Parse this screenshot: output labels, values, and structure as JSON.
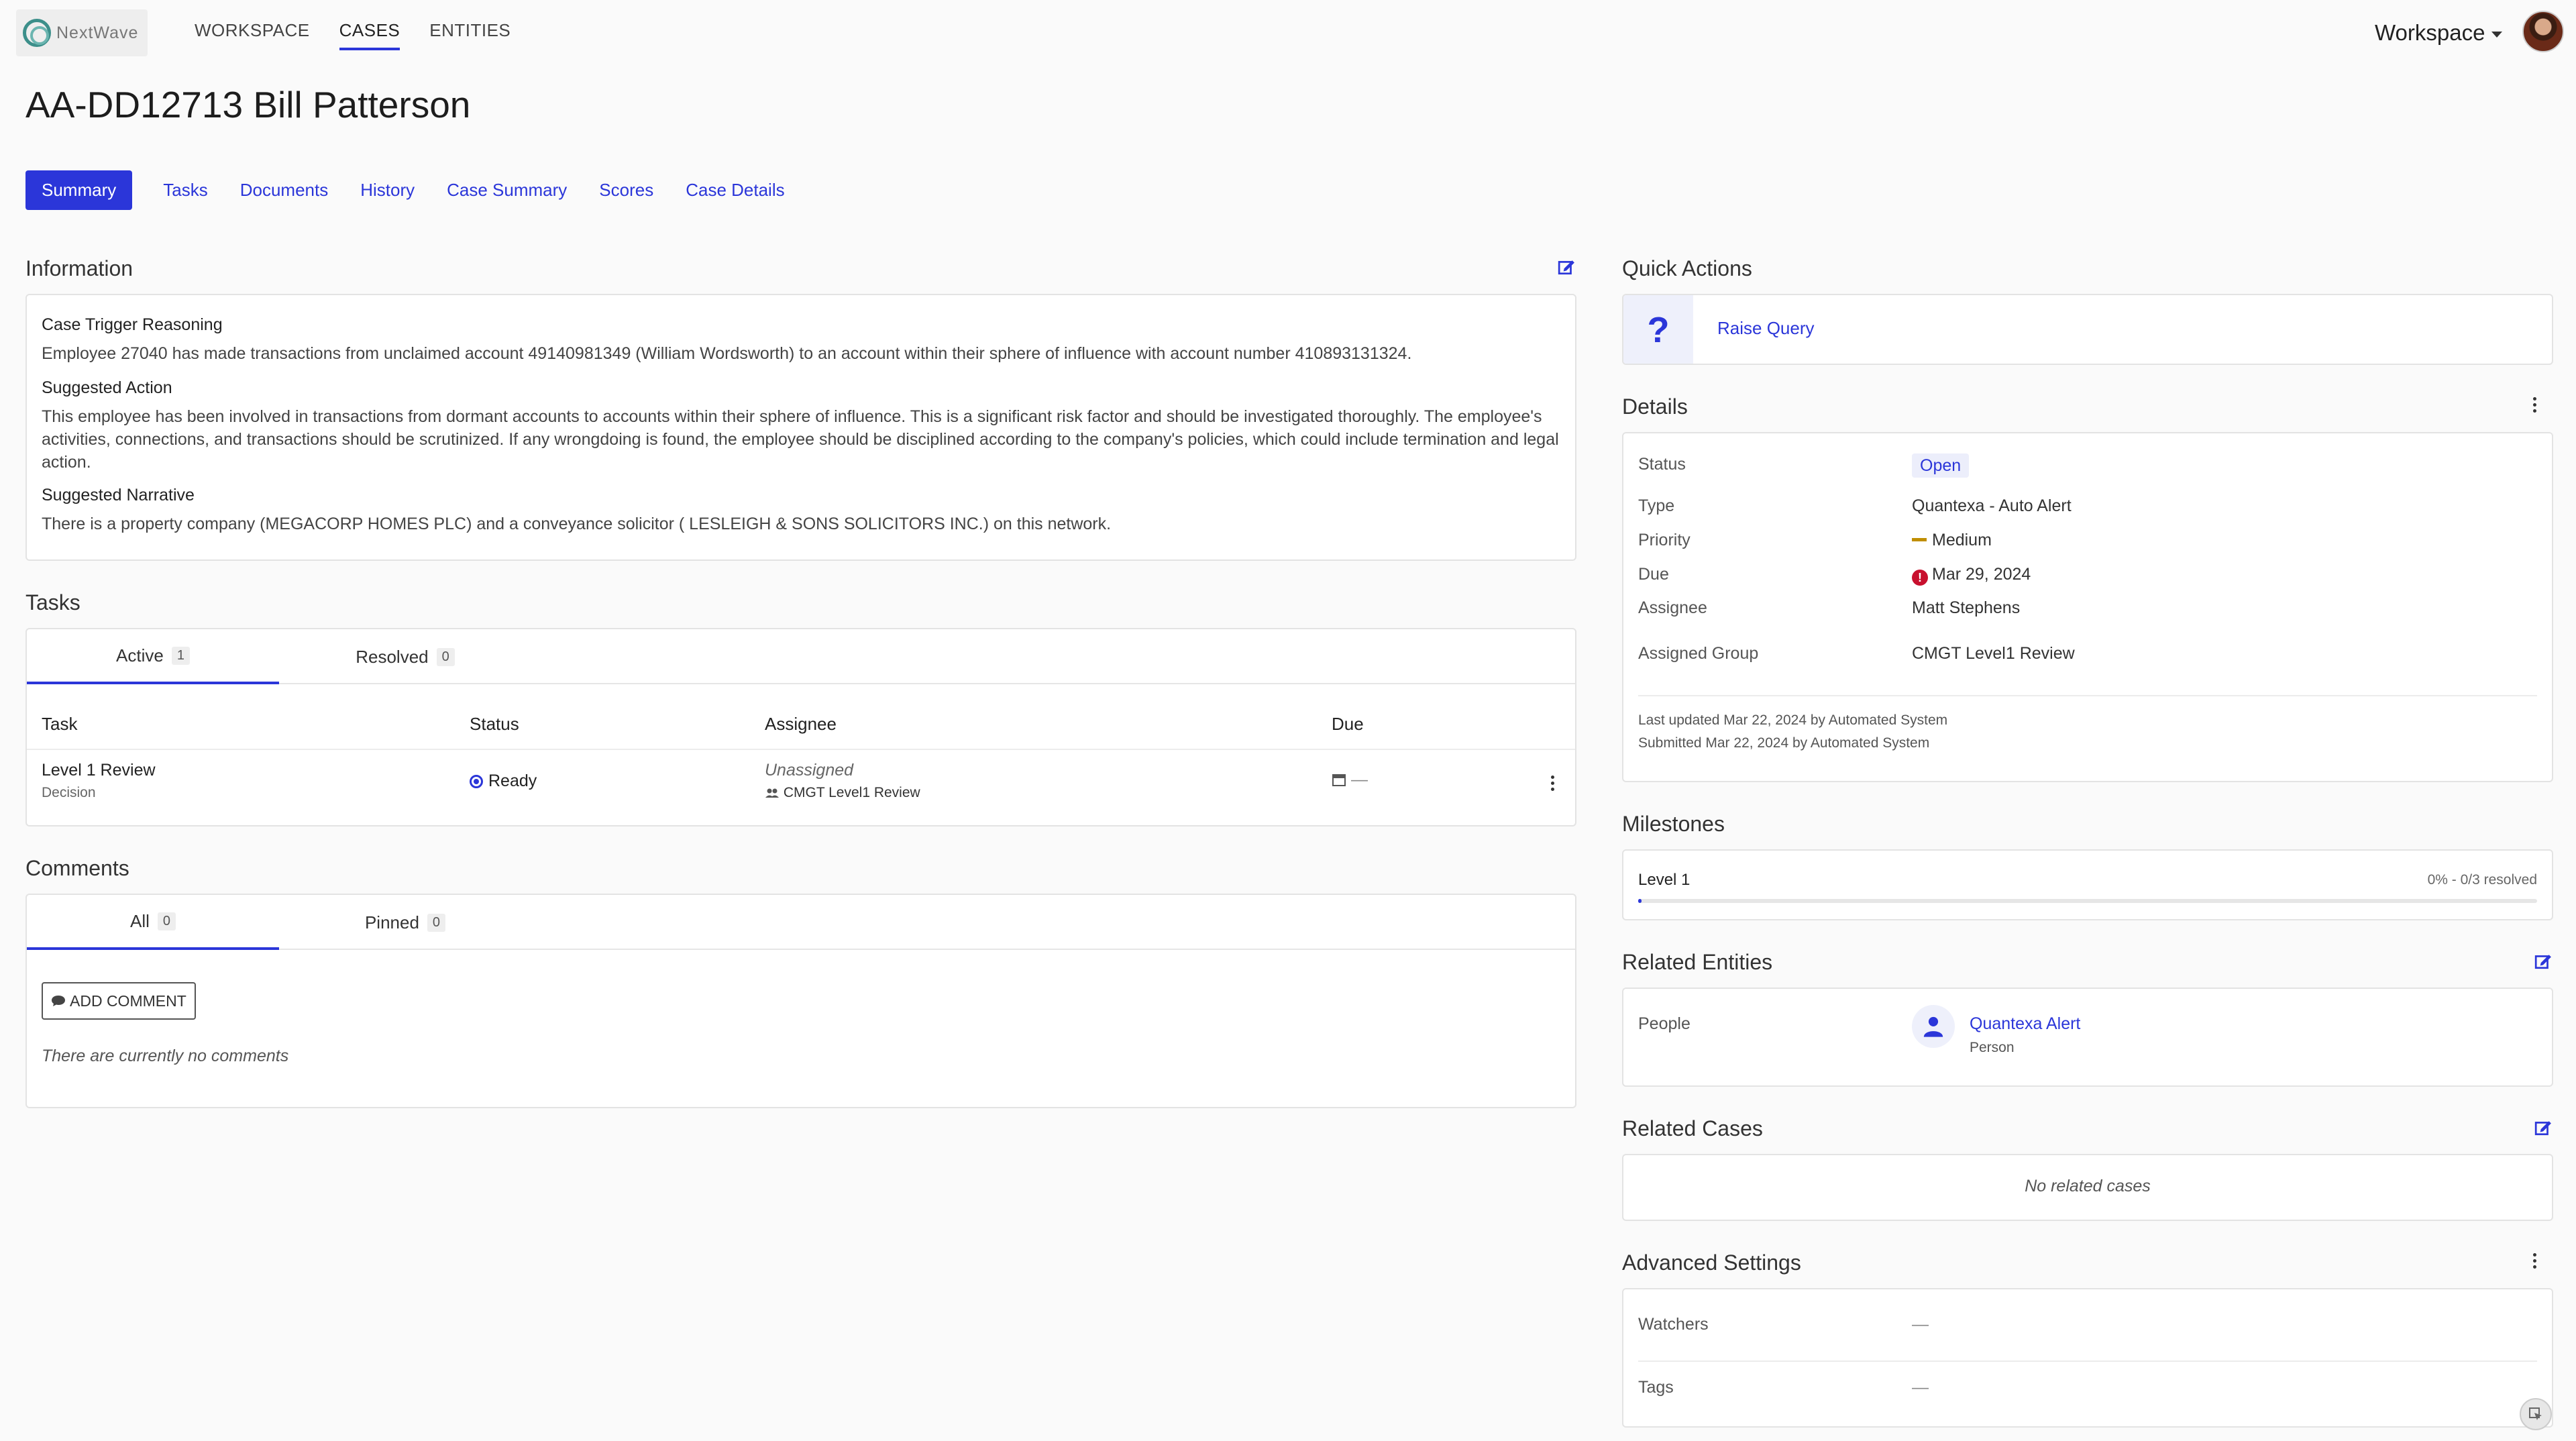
{
  "app": {
    "logo_text": "NextWave",
    "nav": [
      "WORKSPACE",
      "CASES",
      "ENTITIES"
    ],
    "workspace_label": "Workspace"
  },
  "case": {
    "title": "AA-DD12713 Bill Patterson"
  },
  "tabs": [
    "Summary",
    "Tasks",
    "Documents",
    "History",
    "Case Summary",
    "Scores",
    "Case Details"
  ],
  "information": {
    "title": "Information",
    "trigger_label": "Case Trigger Reasoning",
    "trigger_text": "Employee 27040 has made transactions from unclaimed account 49140981349 (William Wordsworth) to an account within their sphere of influence with account number 410893131324.",
    "action_label": "Suggested Action",
    "action_text": "This employee has been involved in transactions from dormant accounts to accounts within their sphere of influence. This is a significant risk factor and should be investigated thoroughly. The employee's activities, connections, and transactions should be scrutinized. If any wrongdoing is found, the employee should be disciplined according to the company's policies, which could include termination and legal action.",
    "narrative_label": "Suggested Narrative",
    "narrative_text": "There is a property company (MEGACORP HOMES PLC) and a conveyance solicitor ( LESLEIGH & SONS SOLICITORS INC.) on this network."
  },
  "tasks": {
    "title": "Tasks",
    "tabs": [
      {
        "label": "Active",
        "count": "1"
      },
      {
        "label": "Resolved",
        "count": "0"
      }
    ],
    "headers": [
      "Task",
      "Status",
      "Assignee",
      "Due"
    ],
    "rows": [
      {
        "task": "Level 1 Review",
        "task_sub": "Decision",
        "status": "Ready",
        "assignee": "Unassigned",
        "group": "CMGT Level1 Review",
        "due": "—"
      }
    ]
  },
  "comments": {
    "title": "Comments",
    "tabs": [
      {
        "label": "All",
        "count": "0"
      },
      {
        "label": "Pinned",
        "count": "0"
      }
    ],
    "add_button": "ADD COMMENT",
    "empty_text": "There are currently no comments"
  },
  "quick_actions": {
    "title": "Quick Actions",
    "icon": "?",
    "action_label": "Raise Query"
  },
  "details": {
    "title": "Details",
    "status_label": "Status",
    "status_value": "Open",
    "type_label": "Type",
    "type_value": "Quantexa - Auto Alert",
    "priority_label": "Priority",
    "priority_value": "Medium",
    "due_label": "Due",
    "due_value": "Mar 29, 2024",
    "assignee_label": "Assignee",
    "assignee_value": "Matt Stephens",
    "group_label": "Assigned Group",
    "group_value": "CMGT Level1 Review",
    "last_updated": "Last updated Mar 22, 2024 by Automated System",
    "submitted": "Submitted Mar 22, 2024 by Automated System",
    "colors": {
      "accent": "#2b36d9",
      "priority_medium": "#c08e00",
      "due_alert": "#c8102e"
    }
  },
  "milestones": {
    "title": "Milestones",
    "name": "Level 1",
    "progress_text": "0% - 0/3 resolved",
    "progress_fraction": 0.0
  },
  "related_entities": {
    "title": "Related Entities",
    "people_label": "People",
    "person_name": "Quantexa Alert",
    "person_type": "Person"
  },
  "related_cases": {
    "title": "Related Cases",
    "empty_text": "No related cases"
  },
  "advanced": {
    "title": "Advanced Settings",
    "watchers_label": "Watchers",
    "watchers_value": "—",
    "tags_label": "Tags",
    "tags_value": "—"
  }
}
